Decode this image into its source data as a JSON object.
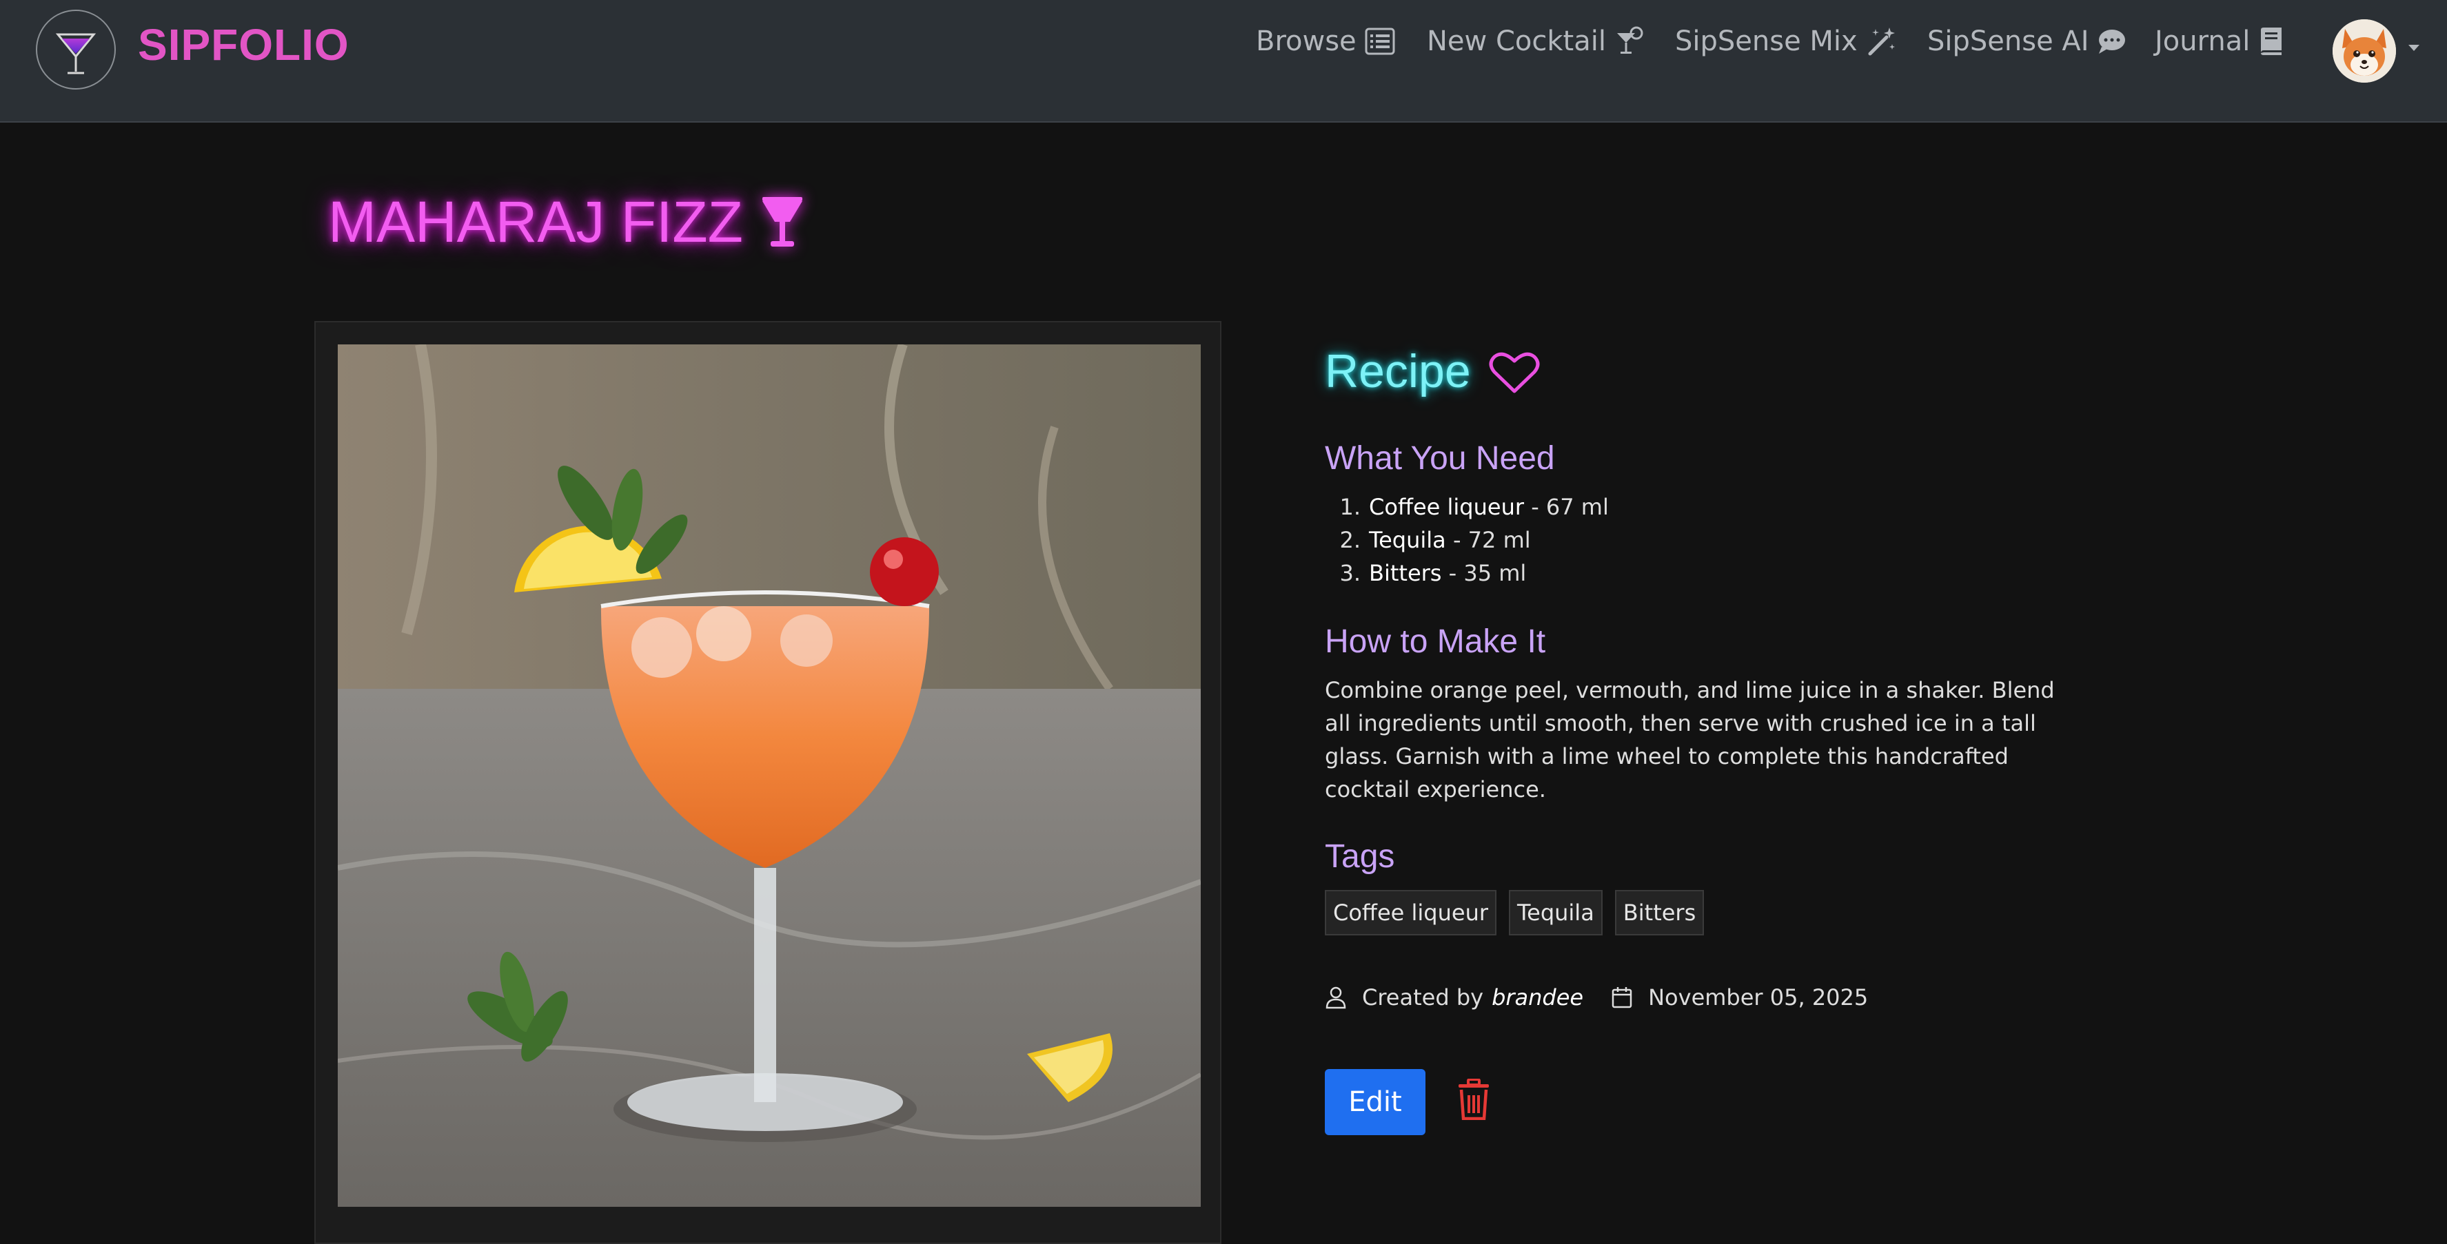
{
  "app": {
    "name": "SIPFOLIO"
  },
  "nav": {
    "links": [
      {
        "label": "Browse",
        "icon": "list-icon"
      },
      {
        "label": "New Cocktail",
        "icon": "cocktail-icon"
      },
      {
        "label": "SipSense Mix",
        "icon": "magic-wand-icon"
      },
      {
        "label": "SipSense AI",
        "icon": "chat-bubble-icon"
      },
      {
        "label": "Journal",
        "icon": "book-icon"
      }
    ],
    "avatar": "user-avatar-fox"
  },
  "cocktail": {
    "name": "MAHARAJ FIZZ",
    "title_icon": "cocktail-glass-icon",
    "photo": "orange cocktail in coupe glass with lemon slice, cherry and mint garnish"
  },
  "recipe": {
    "heading": "Recipe",
    "favorite_icon": "heart-outline-icon",
    "ingredients_heading": "What You Need",
    "ingredients": [
      {
        "number": "1.",
        "name": "Coffee liqueur",
        "amount": " - 67 ml"
      },
      {
        "number": "2.",
        "name": "Tequila",
        "amount": " - 72 ml"
      },
      {
        "number": "3.",
        "name": "Bitters",
        "amount": " - 35 ml"
      }
    ],
    "method_heading": "How to Make It",
    "method_lines": [
      "Combine orange peel, vermouth, and lime juice in a shaker. Blend",
      "all ingredients until smooth, then serve with crushed ice in a tall",
      "glass. Garnish with a lime wheel to complete this handcrafted",
      "cocktail experience."
    ],
    "tags_heading": "Tags",
    "tags": [
      "Coffee liqueur",
      "Tequila",
      "Bitters"
    ],
    "created_by_label": "Created by",
    "author": "brandee",
    "date": "November 05, 2025",
    "edit_label": "Edit",
    "delete_icon": "trash-icon"
  },
  "colors": {
    "brand": "#e255c5",
    "title_neon": "#f25df0",
    "recipe_neon": "#7df2f7",
    "section_heading": "#c9a3f6",
    "edit_button": "#1f6ff0",
    "delete": "#e53935"
  }
}
